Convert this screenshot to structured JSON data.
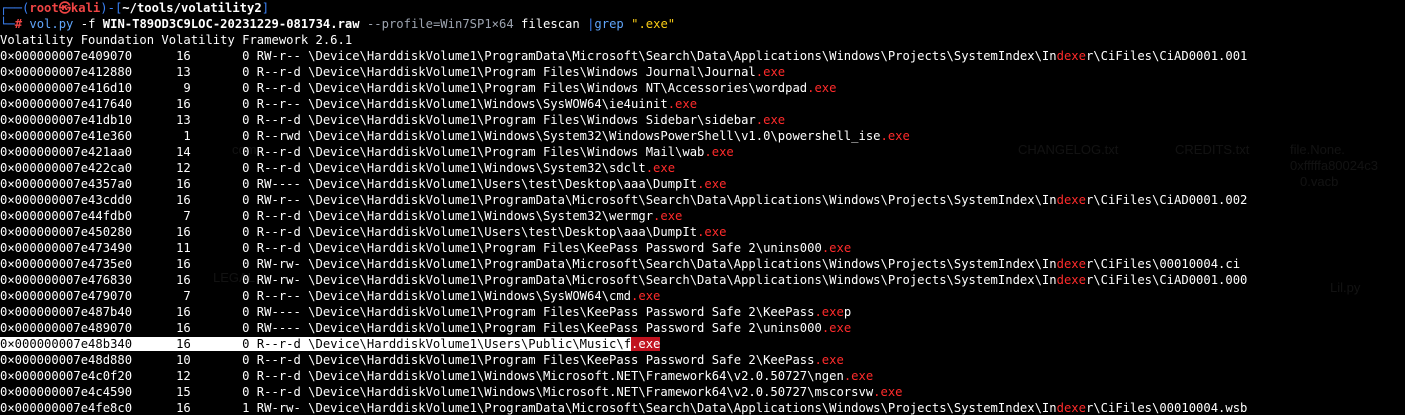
{
  "prompt": {
    "user": "root",
    "at_symbol": "㉿",
    "host": "kali",
    "cwd": "~/tools/volatility2",
    "symbol": "#",
    "command": "vol.py",
    "f_flag": "-f",
    "image_file": "WIN-T89OD3C9LOC-20231229-081734.raw",
    "profile_opt": "--profile=Win7SP1×64",
    "plugin": "filescan",
    "pipe": "|",
    "grep": "grep",
    "grep_pattern": "\".exe\""
  },
  "banner": "Volatility Foundation Volatility Framework 2.6.1",
  "rows": [
    {
      "offset": "0×000000007e409070",
      "ptr": "16",
      "hnd": "0",
      "access": "RW-r--",
      "pre": "\\Device\\HarddiskVolume1\\ProgramData\\Microsoft\\Search\\Data\\Applications\\Windows\\Projects\\SystemIndex\\In",
      "hit": "dexe",
      "post": "r\\CiFiles\\CiAD0001.001"
    },
    {
      "offset": "0×000000007e412880",
      "ptr": "13",
      "hnd": "0",
      "access": "R--r-d",
      "pre": "\\Device\\HarddiskVolume1\\Program Files\\Windows Journal\\Journal",
      "hit": ".exe",
      "post": ""
    },
    {
      "offset": "0×000000007e416d10",
      "ptr": "9",
      "hnd": "0",
      "access": "R--r-d",
      "pre": "\\Device\\HarddiskVolume1\\Program Files\\Windows NT\\Accessories\\wordpad",
      "hit": ".exe",
      "post": ""
    },
    {
      "offset": "0×000000007e417640",
      "ptr": "16",
      "hnd": "0",
      "access": "R--r--",
      "pre": "\\Device\\HarddiskVolume1\\Windows\\SysWOW64\\ie4uinit",
      "hit": ".exe",
      "post": ""
    },
    {
      "offset": "0×000000007e41db10",
      "ptr": "13",
      "hnd": "0",
      "access": "R--r-d",
      "pre": "\\Device\\HarddiskVolume1\\Program Files\\Windows Sidebar\\sidebar",
      "hit": ".exe",
      "post": ""
    },
    {
      "offset": "0×000000007e41e360",
      "ptr": "1",
      "hnd": "0",
      "access": "R--rwd",
      "pre": "\\Device\\HarddiskVolume1\\Windows\\System32\\WindowsPowerShell\\v1.0\\powershell_ise",
      "hit": ".exe",
      "post": ""
    },
    {
      "offset": "0×000000007e421aa0",
      "ptr": "14",
      "hnd": "0",
      "access": "R--r-d",
      "pre": "\\Device\\HarddiskVolume1\\Program Files\\Windows Mail\\wab",
      "hit": ".exe",
      "post": ""
    },
    {
      "offset": "0×000000007e422ca0",
      "ptr": "12",
      "hnd": "0",
      "access": "R--r-d",
      "pre": "\\Device\\HarddiskVolume1\\Windows\\System32\\sdclt",
      "hit": ".exe",
      "post": ""
    },
    {
      "offset": "0×000000007e4357a0",
      "ptr": "16",
      "hnd": "0",
      "access": "RW----",
      "pre": "\\Device\\HarddiskVolume1\\Users\\test\\Desktop\\aaa\\DumpIt",
      "hit": ".exe",
      "post": ""
    },
    {
      "offset": "0×000000007e43cdd0",
      "ptr": "16",
      "hnd": "0",
      "access": "RW-r--",
      "pre": "\\Device\\HarddiskVolume1\\ProgramData\\Microsoft\\Search\\Data\\Applications\\Windows\\Projects\\SystemIndex\\In",
      "hit": "dexe",
      "post": "r\\CiFiles\\CiAD0001.002"
    },
    {
      "offset": "0×000000007e44fdb0",
      "ptr": "7",
      "hnd": "0",
      "access": "R--r-d",
      "pre": "\\Device\\HarddiskVolume1\\Windows\\System32\\wermgr",
      "hit": ".exe",
      "post": ""
    },
    {
      "offset": "0×000000007e450280",
      "ptr": "16",
      "hnd": "0",
      "access": "R--r-d",
      "pre": "\\Device\\HarddiskVolume1\\Users\\test\\Desktop\\aaa\\DumpIt",
      "hit": ".exe",
      "post": ""
    },
    {
      "offset": "0×000000007e473490",
      "ptr": "11",
      "hnd": "0",
      "access": "R--r-d",
      "pre": "\\Device\\HarddiskVolume1\\Program Files\\KeePass Password Safe 2\\unins000",
      "hit": ".exe",
      "post": ""
    },
    {
      "offset": "0×000000007e4735e0",
      "ptr": "16",
      "hnd": "0",
      "access": "RW-rw-",
      "pre": "\\Device\\HarddiskVolume1\\ProgramData\\Microsoft\\Search\\Data\\Applications\\Windows\\Projects\\SystemIndex\\In",
      "hit": "dexe",
      "post": "r\\CiFiles\\00010004.ci"
    },
    {
      "offset": "0×000000007e476830",
      "ptr": "16",
      "hnd": "0",
      "access": "RW-rw-",
      "pre": "\\Device\\HarddiskVolume1\\ProgramData\\Microsoft\\Search\\Data\\Applications\\Windows\\Projects\\SystemIndex\\In",
      "hit": "dexe",
      "post": "r\\CiFiles\\CiAD0001.000"
    },
    {
      "offset": "0×000000007e479070",
      "ptr": "7",
      "hnd": "0",
      "access": "R--r--",
      "pre": "\\Device\\HarddiskVolume1\\Windows\\SysWOW64\\cmd",
      "hit": ".exe",
      "post": ""
    },
    {
      "offset": "0×000000007e487b40",
      "ptr": "16",
      "hnd": "0",
      "access": "RW----",
      "pre": "\\Device\\HarddiskVolume1\\Program Files\\KeePass Password Safe 2\\KeePass",
      "hit": ".exe",
      "post": "p"
    },
    {
      "offset": "0×000000007e489070",
      "ptr": "16",
      "hnd": "0",
      "access": "RW----",
      "pre": "\\Device\\HarddiskVolume1\\Program Files\\KeePass Password Safe 2\\unins000",
      "hit": ".exe",
      "post": ""
    },
    {
      "offset": "0×000000007e48b340",
      "ptr": "16",
      "hnd": "0",
      "access": "R--r-d",
      "pre": "\\Device\\HarddiskVolume1\\Users\\Public\\Music\\f",
      "hit": ".exe",
      "post": "",
      "selected": true
    },
    {
      "offset": "0×000000007e48d880",
      "ptr": "10",
      "hnd": "0",
      "access": "R--r-d",
      "pre": "\\Device\\HarddiskVolume1\\Program Files\\KeePass Password Safe 2\\KeePass",
      "hit": ".exe",
      "post": ""
    },
    {
      "offset": "0×000000007e4c0f20",
      "ptr": "12",
      "hnd": "0",
      "access": "R--r-d",
      "pre": "\\Device\\HarddiskVolume1\\Windows\\Microsoft.NET\\Framework64\\v2.0.50727\\ngen",
      "hit": ".exe",
      "post": ""
    },
    {
      "offset": "0×000000007e4c4590",
      "ptr": "15",
      "hnd": "0",
      "access": "R--r-d",
      "pre": "\\Device\\HarddiskVolume1\\Windows\\Microsoft.NET\\Framework64\\v2.0.50727\\mscorsvw",
      "hit": ".exe",
      "post": ""
    },
    {
      "offset": "0×000000007e4fe8c0",
      "ptr": "16",
      "hnd": "1",
      "access": "RW-rw-",
      "pre": "\\Device\\HarddiskVolume1\\ProgramData\\Microsoft\\Search\\Data\\Applications\\Windows\\Projects\\SystemIndex\\In",
      "hit": "dexe",
      "post": "r\\CiFiles\\00010004.wsb"
    }
  ],
  "desktop_ghosts": [
    "CHANGELOG.txt",
    "CREDITS.txt",
    "file.None.",
    "0xfffffa80024c3",
    "0.vacb",
    "com",
    "LEGAL",
    "Lil.py"
  ],
  "colors": {
    "prompt_line": "#3b82f6",
    "root": "#ef4444",
    "match": "#ff2b2b",
    "grep_string": "#facc15",
    "selection_bg": "#ffffff",
    "selection_match_bg": "#c1121f"
  }
}
